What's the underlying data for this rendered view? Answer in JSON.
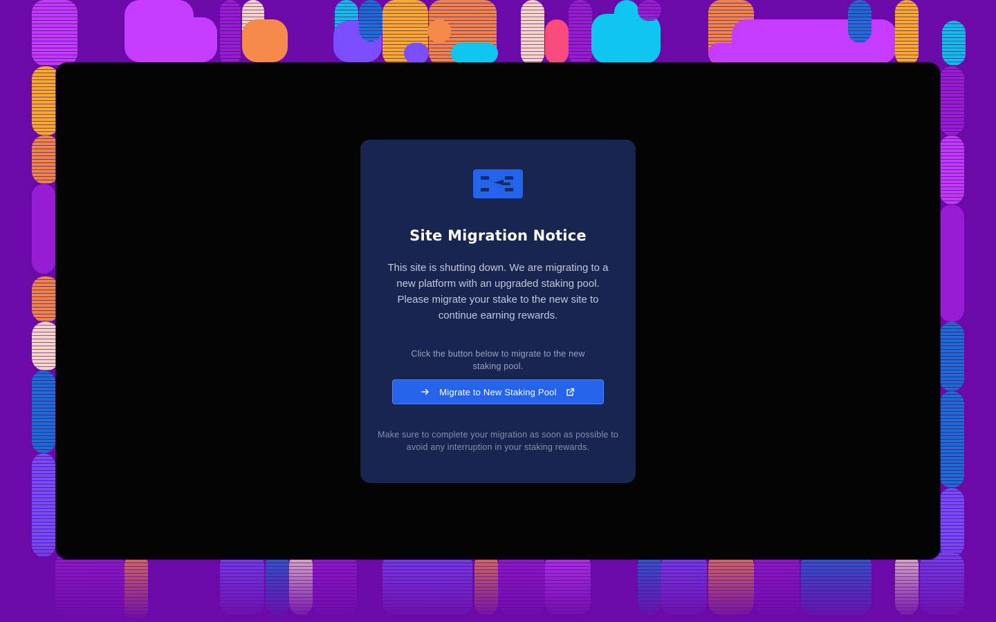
{
  "colors": {
    "page_background": "#6b0aa8",
    "window_background": "#040404",
    "card_background": "#182550",
    "accent_button": "#2563eb",
    "logo": "#2463eb",
    "deco_palette": [
      "#c63cff",
      "#f58a4a",
      "#0ec5ef",
      "#ffb12a",
      "#ff4e7a",
      "#7a4dff",
      "#1e6fd8",
      "#ffe0d0",
      "#9b1ed6"
    ]
  },
  "modal": {
    "logo_icon": "b3-logo-icon",
    "title": "Site Migration Notice",
    "description": "This site is shutting down. We are migrating to a new platform with an upgraded staking pool. Please migrate your stake to the new site to continue earning rewards.",
    "instruction": "Click the button below to migrate to the new staking pool.",
    "button": {
      "label": "Migrate to New Staking Pool",
      "leading_icon": "arrow-right-icon",
      "trailing_icon": "external-link-icon"
    },
    "footer_note": "Make sure to complete your migration as soon as possible to avoid any interruption in your staking rewards."
  }
}
